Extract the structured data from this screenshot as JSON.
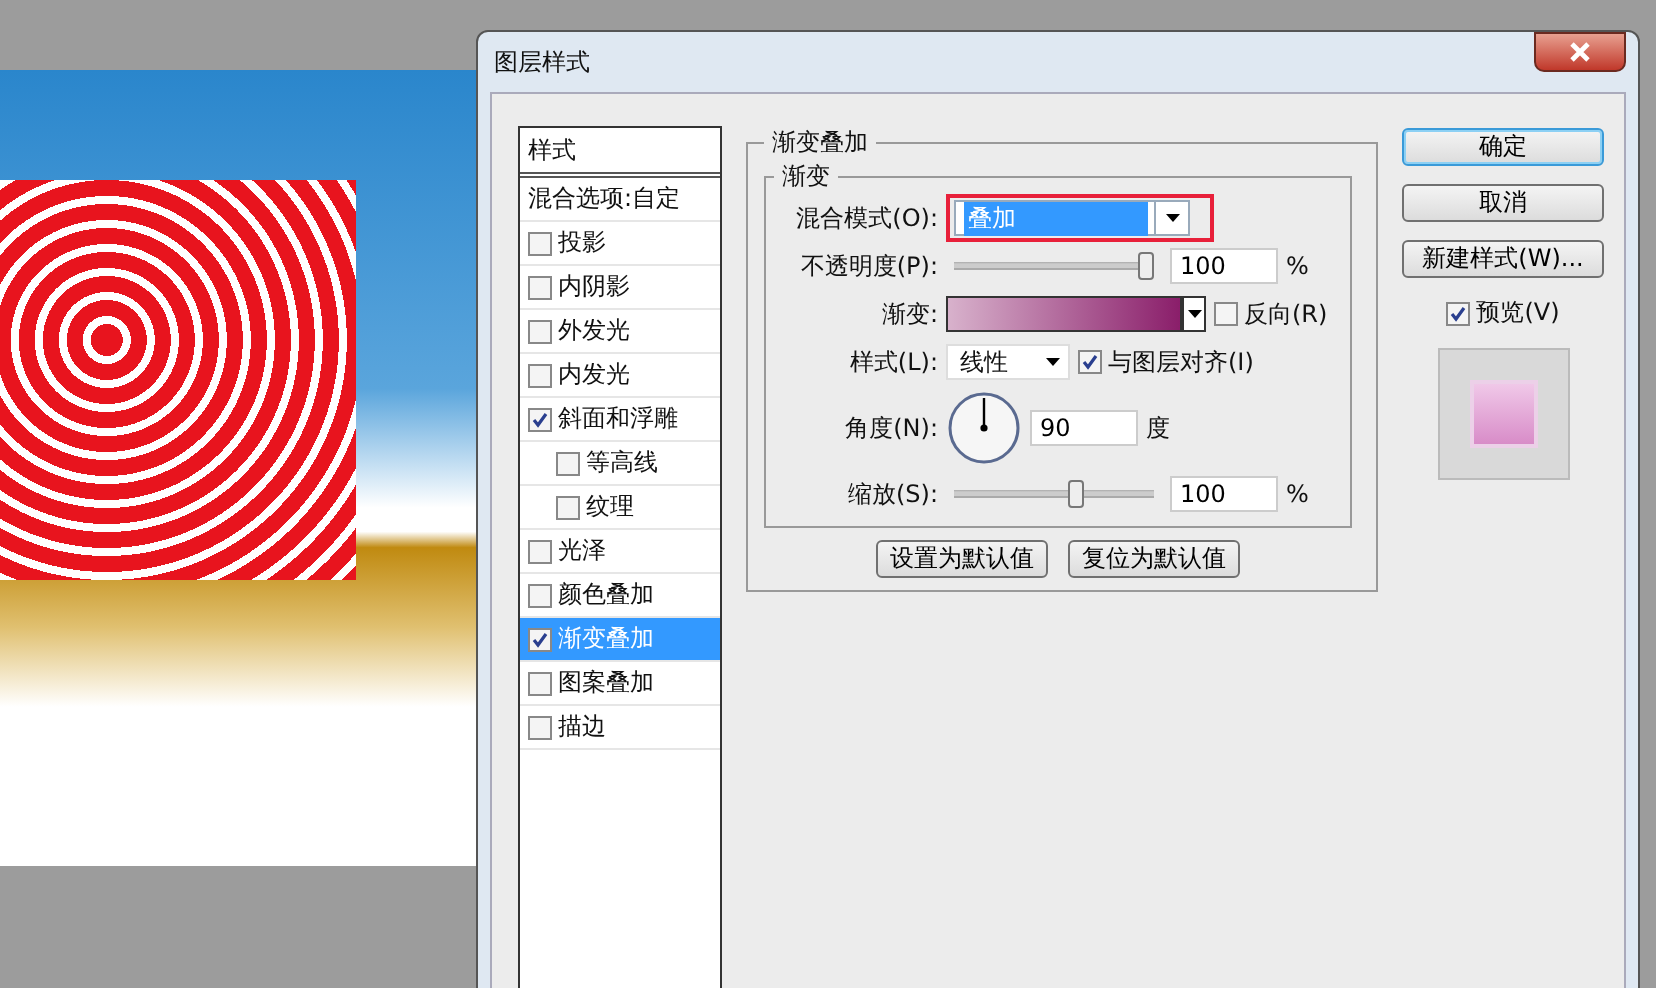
{
  "window": {
    "title": "图层样式"
  },
  "styles_list": {
    "header": "样式",
    "items": [
      {
        "label": "混合选项:自定",
        "kind": "plain",
        "selected": false
      },
      {
        "label": "投影",
        "kind": "check",
        "checked": false,
        "selected": false
      },
      {
        "label": "内阴影",
        "kind": "check",
        "checked": false,
        "selected": false
      },
      {
        "label": "外发光",
        "kind": "check",
        "checked": false,
        "selected": false
      },
      {
        "label": "内发光",
        "kind": "check",
        "checked": false,
        "selected": false
      },
      {
        "label": "斜面和浮雕",
        "kind": "check",
        "checked": true,
        "selected": false,
        "children": [
          {
            "label": "等高线",
            "kind": "check",
            "checked": false,
            "selected": false
          },
          {
            "label": "纹理",
            "kind": "check",
            "checked": false,
            "selected": false
          }
        ]
      },
      {
        "label": "光泽",
        "kind": "check",
        "checked": false,
        "selected": false
      },
      {
        "label": "颜色叠加",
        "kind": "check",
        "checked": false,
        "selected": false
      },
      {
        "label": "渐变叠加",
        "kind": "check",
        "checked": true,
        "selected": true
      },
      {
        "label": "图案叠加",
        "kind": "check",
        "checked": false,
        "selected": false
      },
      {
        "label": "描边",
        "kind": "check",
        "checked": false,
        "selected": false
      }
    ]
  },
  "panel": {
    "title": "渐变叠加",
    "group_title": "渐变",
    "blend_mode": {
      "label": "混合模式(O):",
      "value": "叠加",
      "highlighted": true
    },
    "opacity": {
      "label": "不透明度(P):",
      "level": 0.97,
      "value": "100",
      "unit": "%"
    },
    "gradient": {
      "label": "渐变:",
      "reverse": {
        "label": "反向(R)",
        "checked": false
      }
    },
    "style": {
      "label": "样式(L):",
      "value": "线性",
      "align": {
        "label": "与图层对齐(I)",
        "checked": true
      }
    },
    "angle": {
      "label": "角度(N):",
      "value": "90",
      "unit": "度"
    },
    "scale": {
      "label": "缩放(S):",
      "level": 0.62,
      "value": "100",
      "unit": "%"
    },
    "buttons": [
      "设置为默认值",
      "复位为默认值"
    ]
  },
  "actions": {
    "buttons": [
      {
        "label": "确定",
        "default": true
      },
      {
        "label": "取消",
        "default": false
      },
      {
        "label": "新建样式(W)...",
        "default": false
      }
    ],
    "preview": {
      "label": "预览(V)",
      "checked": true
    }
  }
}
